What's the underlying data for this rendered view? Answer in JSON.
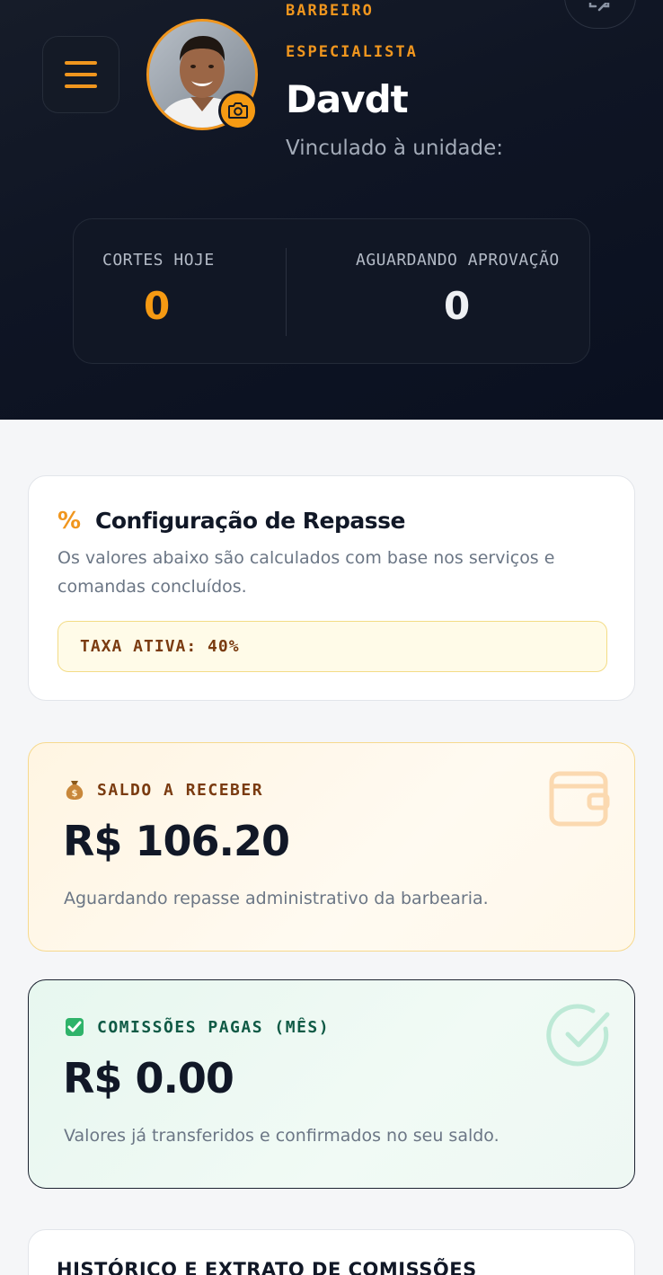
{
  "header": {
    "role_line1": "BARBEIRO",
    "role_line2": "ESPECIALISTA",
    "name": "Davdt",
    "unit_label": "Vinculado à unidade:",
    "stats": {
      "cortes_label": "CORTES HOJE",
      "cortes_value": "0",
      "aguardando_label": "AGUARDANDO APROVAÇÃO",
      "aguardando_value": "0"
    }
  },
  "icons": {
    "menu": "menu-icon",
    "camera": "camera-icon",
    "logout": "logout-icon",
    "percent": "percent-icon",
    "money_bag": "money-bag-icon",
    "wallet": "wallet-icon",
    "check_box": "check-box-icon",
    "check_circle": "check-circle-icon"
  },
  "colors": {
    "accent": "#f0961e",
    "header_bg": "#0f1524",
    "saldo_label": "#7a3b10",
    "pagas_label": "#0f5a45"
  },
  "config": {
    "percent_glyph": "%",
    "title": "Configuração de Repasse",
    "description": "Os valores abaixo são calculados com base nos serviços e comandas concluídos.",
    "taxa": "TAXA ATIVA: 40%"
  },
  "saldo": {
    "label": "SALDO A RECEBER",
    "amount": "R$ 106.20",
    "note": "Aguardando repasse administrativo da barbearia."
  },
  "pagas": {
    "label": "COMISSÕES PAGAS (MÊS)",
    "amount": "R$ 0.00",
    "note": "Valores já transferidos e confirmados no seu saldo."
  },
  "historico": {
    "title": "HISTÓRICO E EXTRATO DE COMISSÕES"
  }
}
